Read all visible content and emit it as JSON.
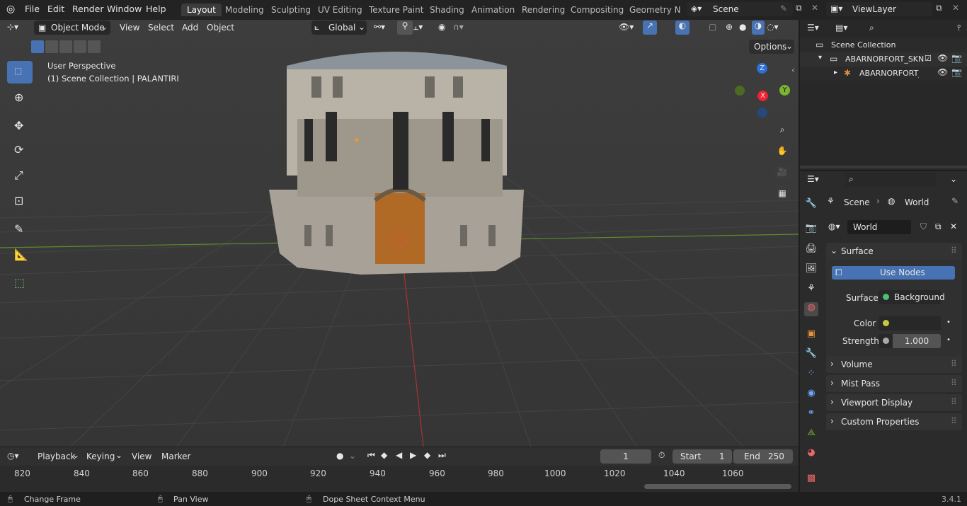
{
  "menubar": {
    "items": [
      "File",
      "Edit",
      "Render",
      "Window",
      "Help"
    ],
    "workspaces": [
      "Layout",
      "Modeling",
      "Sculpting",
      "UV Editing",
      "Texture Paint",
      "Shading",
      "Animation",
      "Rendering",
      "Compositing",
      "Geometry Noc"
    ],
    "scene": "Scene",
    "view_layer": "ViewLayer"
  },
  "viewport_header": {
    "mode": "Object Mode",
    "menus": [
      "View",
      "Select",
      "Add",
      "Object"
    ],
    "orientation": "Global",
    "options": "Options"
  },
  "viewport": {
    "perspective": "User Perspective",
    "collection": "(1) Scene Collection | PALANTIRI",
    "gizmo": {
      "z": "Z",
      "x": "X",
      "y": "Y"
    }
  },
  "outliner": {
    "root": "Scene Collection",
    "items": [
      "ABARNORFORT_SKN",
      "ABARNORFORT_"
    ]
  },
  "properties": {
    "breadcrumb_scene": "Scene",
    "breadcrumb_world": "World",
    "world_name": "World",
    "surface_panel": "Surface",
    "use_nodes": "Use Nodes",
    "surface_label": "Surface",
    "surface_value": "Background",
    "color_label": "Color",
    "strength_label": "Strength",
    "strength_value": "1.000",
    "panels": [
      "Volume",
      "Mist Pass",
      "Viewport Display",
      "Custom Properties"
    ]
  },
  "timeline": {
    "menus": [
      "Playback",
      "Keying",
      "View",
      "Marker"
    ],
    "current_frame": "1",
    "start_label": "Start",
    "start_value": "1",
    "end_label": "End",
    "end_value": "250",
    "ticks": [
      "820",
      "840",
      "860",
      "880",
      "900",
      "920",
      "940",
      "960",
      "980",
      "1000",
      "1020",
      "1040",
      "1060"
    ]
  },
  "statusbar": {
    "hint1": "Change Frame",
    "hint2": "Pan View",
    "hint3": "Dope Sheet Context Menu",
    "version": "3.4.1"
  },
  "colors": {
    "accent": "#4772b3",
    "bg": "#3a3a3a",
    "panel": "#2b2b2b"
  }
}
